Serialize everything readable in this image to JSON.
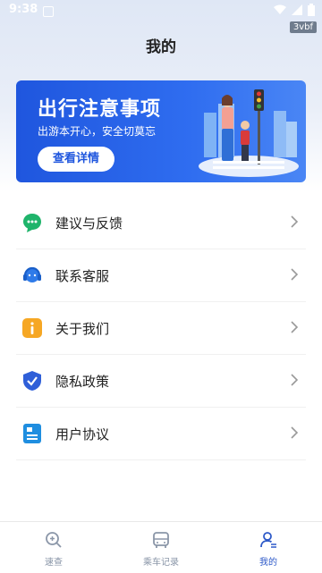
{
  "status": {
    "time": "9:38"
  },
  "tag": "3vbf",
  "header": {
    "title": "我的"
  },
  "banner": {
    "title": "出行注意事项",
    "subtitle": "出游本开心，安全切莫忘",
    "button": "查看详情"
  },
  "menu": [
    {
      "label": "建议与反馈",
      "icon": "chat-bubble-icon",
      "color": "#1fb46b"
    },
    {
      "label": "联系客服",
      "icon": "headset-icon",
      "color": "#2f7be9"
    },
    {
      "label": "关于我们",
      "icon": "info-icon",
      "color": "#f6a724"
    },
    {
      "label": "隐私政策",
      "icon": "shield-check-icon",
      "color": "#2f5fd8"
    },
    {
      "label": "用户协议",
      "icon": "document-icon",
      "color": "#1f8ee0"
    }
  ],
  "tabs": [
    {
      "label": "速查",
      "icon": "search-icon"
    },
    {
      "label": "乘车记录",
      "icon": "bus-icon"
    },
    {
      "label": "我的",
      "icon": "user-icon",
      "active": true
    }
  ],
  "colors": {
    "accent": "#2d59c8",
    "banner": "#1f56de"
  }
}
